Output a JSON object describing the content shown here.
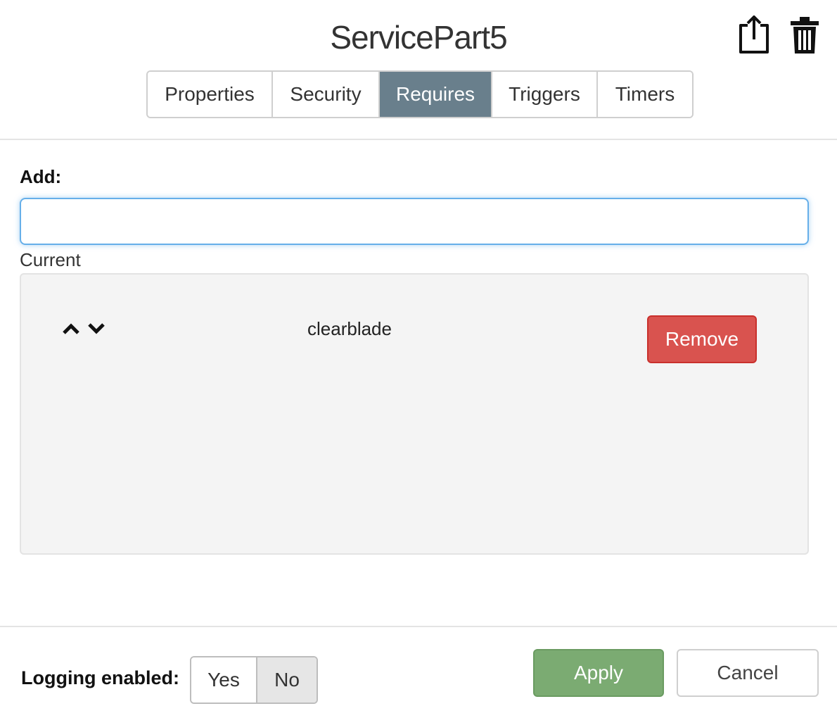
{
  "header": {
    "title": "ServicePart5",
    "icons": [
      "export-icon",
      "trash-icon"
    ]
  },
  "tabs": [
    {
      "label": "Properties",
      "active": false
    },
    {
      "label": "Security",
      "active": false
    },
    {
      "label": "Requires",
      "active": true
    },
    {
      "label": "Triggers",
      "active": false
    },
    {
      "label": "Timers",
      "active": false
    }
  ],
  "add": {
    "label": "Add:",
    "value": "",
    "placeholder": ""
  },
  "current": {
    "label": "Current",
    "items": [
      {
        "name": "clearblade",
        "remove_label": "Remove"
      }
    ],
    "icons": [
      "chevron-up-icon",
      "chevron-down-icon"
    ]
  },
  "footer": {
    "logging_label": "Logging enabled:",
    "logging_options": [
      "Yes",
      "No"
    ],
    "logging_selected": "No",
    "apply_label": "Apply",
    "cancel_label": "Cancel"
  },
  "colors": {
    "active_tab": "#697f8c",
    "remove": "#d9534f",
    "apply": "#7bab72",
    "focus": "#66afe9"
  }
}
